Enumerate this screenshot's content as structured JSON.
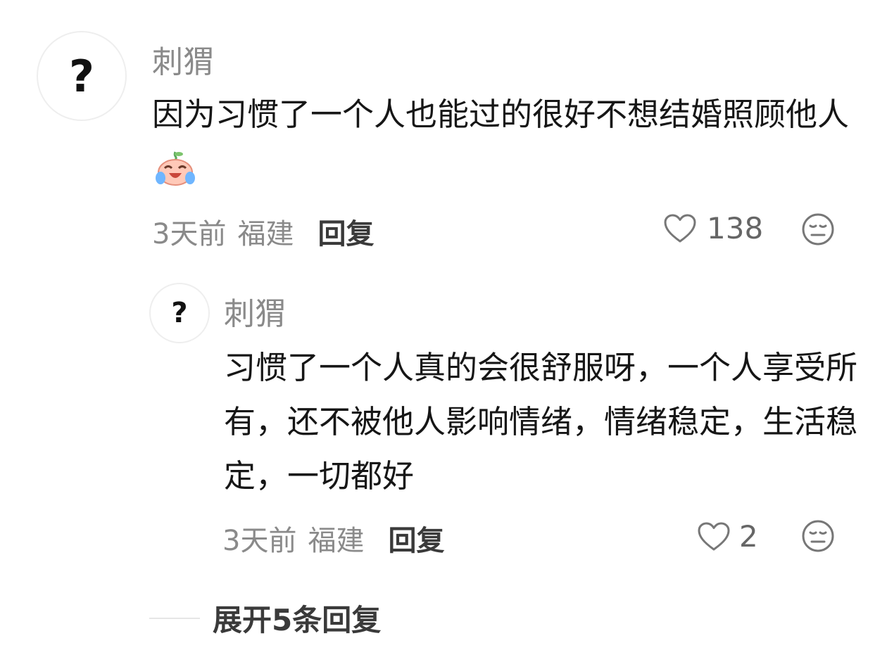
{
  "comments": [
    {
      "avatar_glyph": "?",
      "username": "刺猬",
      "text": "因为习惯了一个人也能过的很好不想结婚照顾他人",
      "emoji_icon": "laugh-cry-emoji-icon",
      "time": "3天前",
      "location": "福建",
      "reply_label": "回复",
      "like_count": "138"
    }
  ],
  "replies": [
    {
      "avatar_glyph": "?",
      "username": "刺猬",
      "text": "习惯了一个人真的会很舒服呀，一个人享受所有，还不被他人影响情绪，情绪稳定，生活稳定，一切都好",
      "time": "3天前",
      "location": "福建",
      "reply_label": "回复",
      "like_count": "2"
    }
  ],
  "expand_label": "展开5条回复",
  "colors": {
    "meta_gray": "#8a8a8a",
    "text": "#161616",
    "reply_label": "#3a3a3a"
  }
}
